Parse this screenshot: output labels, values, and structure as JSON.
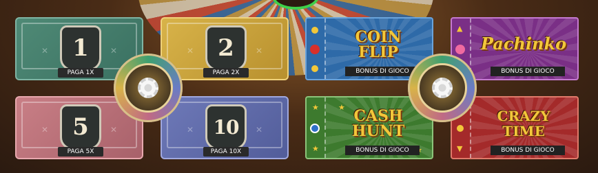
{
  "bets": [
    {
      "id": "bet-1",
      "number": "1",
      "label": "PAGA 1X"
    },
    {
      "id": "bet-2",
      "number": "2",
      "label": "PAGA 2X"
    },
    {
      "id": "bet-5",
      "number": "5",
      "label": "PAGA 5X"
    },
    {
      "id": "bet-10",
      "number": "10",
      "label": "PAGA 10X"
    }
  ],
  "bonuses": [
    {
      "id": "coin-flip",
      "title": "COIN\nFLIP",
      "label": "BONUS DI GIOCO"
    },
    {
      "id": "pachinko",
      "title": "Pachinko",
      "label": "BONUS DI GIOCO"
    },
    {
      "id": "cash-hunt",
      "title": "CASH\nHUNT",
      "label": "BONUS DI GIOCO"
    },
    {
      "id": "crazy-time",
      "title": "CRAZY\nTIME",
      "label": "BONUS DI GIOCO"
    }
  ],
  "colors": {
    "bet_1": "#4f8a76",
    "bet_2": "#d8b349",
    "bet_5": "#c97f86",
    "bet_10": "#6e79b8",
    "coin_flip": "#2e6aa8",
    "pachinko": "#7a2f86",
    "cash_hunt": "#3d7a2e",
    "crazy_time": "#a42a2a",
    "title_gold": "#f2c73a"
  },
  "icons": {
    "chip": "poker-chip-icon",
    "wheel": "wheel-icon"
  }
}
